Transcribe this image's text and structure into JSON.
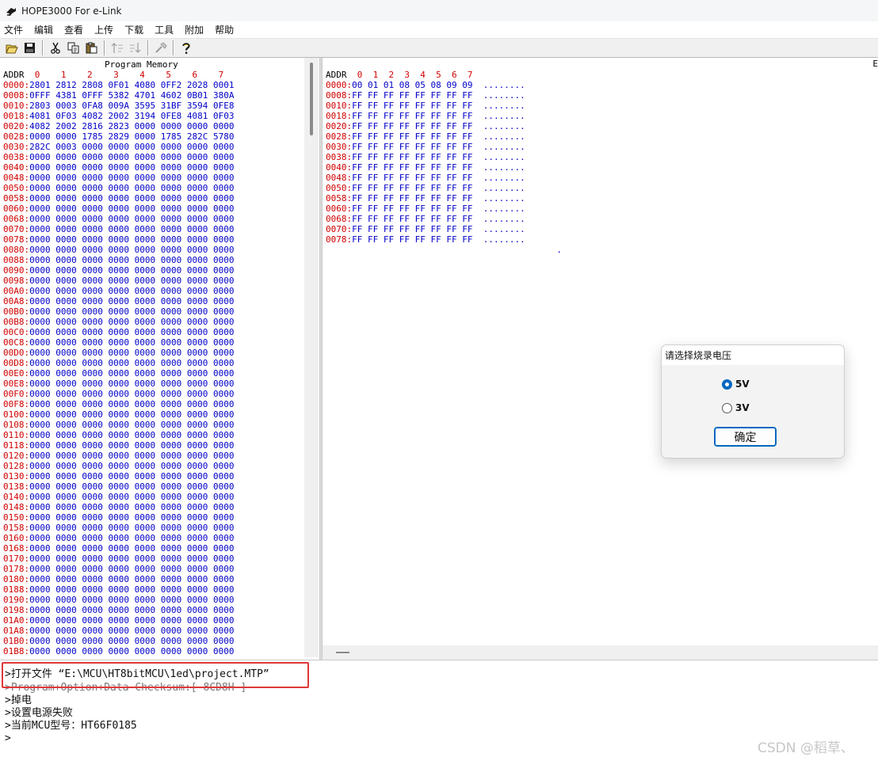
{
  "window": {
    "title": "HOPE3000 For e-Link"
  },
  "menu": [
    "文件",
    "编辑",
    "查看",
    "上传",
    "下载",
    "工具",
    "附加",
    "帮助"
  ],
  "toolbar": {
    "icons": [
      "open-folder-icon",
      "save-icon",
      "cut-icon",
      "copy-icon",
      "paste-icon",
      "upload-icon",
      "download-icon",
      "tool-icon",
      "help-icon"
    ]
  },
  "program_memory": {
    "title": "Program Memory",
    "addr_label": "ADDR",
    "columns": [
      "0",
      "1",
      "2",
      "3",
      "4",
      "5",
      "6",
      "7"
    ],
    "rows": [
      {
        "addr": "0000",
        "values": [
          "2801",
          "2812",
          "2808",
          "0F01",
          "4080",
          "0FF2",
          "2028",
          "0001"
        ]
      },
      {
        "addr": "0008",
        "values": [
          "0FFF",
          "4381",
          "0FFF",
          "5382",
          "4701",
          "4602",
          "0B01",
          "380A"
        ]
      },
      {
        "addr": "0010",
        "values": [
          "2803",
          "0003",
          "0FA8",
          "009A",
          "3595",
          "31BF",
          "3594",
          "0FE8"
        ]
      },
      {
        "addr": "0018",
        "values": [
          "4081",
          "0F03",
          "4082",
          "2002",
          "3194",
          "0FE8",
          "4081",
          "0F03"
        ]
      },
      {
        "addr": "0020",
        "values": [
          "4082",
          "2002",
          "2816",
          "2823",
          "0000",
          "0000",
          "0000",
          "0000"
        ]
      },
      {
        "addr": "0028",
        "values": [
          "0000",
          "0000",
          "1785",
          "2829",
          "0000",
          "1785",
          "282C",
          "5780"
        ]
      },
      {
        "addr": "0030",
        "values": [
          "282C",
          "0003",
          "0000",
          "0000",
          "0000",
          "0000",
          "0000",
          "0000"
        ]
      },
      {
        "addr": "0038",
        "values": [
          "0000",
          "0000",
          "0000",
          "0000",
          "0000",
          "0000",
          "0000",
          "0000"
        ]
      },
      {
        "addr": "0040",
        "values": [
          "0000",
          "0000",
          "0000",
          "0000",
          "0000",
          "0000",
          "0000",
          "0000"
        ]
      },
      {
        "addr": "0048",
        "values": [
          "0000",
          "0000",
          "0000",
          "0000",
          "0000",
          "0000",
          "0000",
          "0000"
        ]
      },
      {
        "addr": "0050",
        "values": [
          "0000",
          "0000",
          "0000",
          "0000",
          "0000",
          "0000",
          "0000",
          "0000"
        ]
      },
      {
        "addr": "0058",
        "values": [
          "0000",
          "0000",
          "0000",
          "0000",
          "0000",
          "0000",
          "0000",
          "0000"
        ]
      },
      {
        "addr": "0060",
        "values": [
          "0000",
          "0000",
          "0000",
          "0000",
          "0000",
          "0000",
          "0000",
          "0000"
        ]
      },
      {
        "addr": "0068",
        "values": [
          "0000",
          "0000",
          "0000",
          "0000",
          "0000",
          "0000",
          "0000",
          "0000"
        ]
      },
      {
        "addr": "0070",
        "values": [
          "0000",
          "0000",
          "0000",
          "0000",
          "0000",
          "0000",
          "0000",
          "0000"
        ]
      },
      {
        "addr": "0078",
        "values": [
          "0000",
          "0000",
          "0000",
          "0000",
          "0000",
          "0000",
          "0000",
          "0000"
        ]
      },
      {
        "addr": "0080",
        "values": [
          "0000",
          "0000",
          "0000",
          "0000",
          "0000",
          "0000",
          "0000",
          "0000"
        ]
      },
      {
        "addr": "0088",
        "values": [
          "0000",
          "0000",
          "0000",
          "0000",
          "0000",
          "0000",
          "0000",
          "0000"
        ]
      },
      {
        "addr": "0090",
        "values": [
          "0000",
          "0000",
          "0000",
          "0000",
          "0000",
          "0000",
          "0000",
          "0000"
        ]
      },
      {
        "addr": "0098",
        "values": [
          "0000",
          "0000",
          "0000",
          "0000",
          "0000",
          "0000",
          "0000",
          "0000"
        ]
      },
      {
        "addr": "00A0",
        "values": [
          "0000",
          "0000",
          "0000",
          "0000",
          "0000",
          "0000",
          "0000",
          "0000"
        ]
      },
      {
        "addr": "00A8",
        "values": [
          "0000",
          "0000",
          "0000",
          "0000",
          "0000",
          "0000",
          "0000",
          "0000"
        ]
      },
      {
        "addr": "00B0",
        "values": [
          "0000",
          "0000",
          "0000",
          "0000",
          "0000",
          "0000",
          "0000",
          "0000"
        ]
      },
      {
        "addr": "00B8",
        "values": [
          "0000",
          "0000",
          "0000",
          "0000",
          "0000",
          "0000",
          "0000",
          "0000"
        ]
      },
      {
        "addr": "00C0",
        "values": [
          "0000",
          "0000",
          "0000",
          "0000",
          "0000",
          "0000",
          "0000",
          "0000"
        ]
      },
      {
        "addr": "00C8",
        "values": [
          "0000",
          "0000",
          "0000",
          "0000",
          "0000",
          "0000",
          "0000",
          "0000"
        ]
      },
      {
        "addr": "00D0",
        "values": [
          "0000",
          "0000",
          "0000",
          "0000",
          "0000",
          "0000",
          "0000",
          "0000"
        ]
      },
      {
        "addr": "00D8",
        "values": [
          "0000",
          "0000",
          "0000",
          "0000",
          "0000",
          "0000",
          "0000",
          "0000"
        ]
      },
      {
        "addr": "00E0",
        "values": [
          "0000",
          "0000",
          "0000",
          "0000",
          "0000",
          "0000",
          "0000",
          "0000"
        ]
      },
      {
        "addr": "00E8",
        "values": [
          "0000",
          "0000",
          "0000",
          "0000",
          "0000",
          "0000",
          "0000",
          "0000"
        ]
      },
      {
        "addr": "00F0",
        "values": [
          "0000",
          "0000",
          "0000",
          "0000",
          "0000",
          "0000",
          "0000",
          "0000"
        ]
      },
      {
        "addr": "00F8",
        "values": [
          "0000",
          "0000",
          "0000",
          "0000",
          "0000",
          "0000",
          "0000",
          "0000"
        ]
      },
      {
        "addr": "0100",
        "values": [
          "0000",
          "0000",
          "0000",
          "0000",
          "0000",
          "0000",
          "0000",
          "0000"
        ]
      },
      {
        "addr": "0108",
        "values": [
          "0000",
          "0000",
          "0000",
          "0000",
          "0000",
          "0000",
          "0000",
          "0000"
        ]
      },
      {
        "addr": "0110",
        "values": [
          "0000",
          "0000",
          "0000",
          "0000",
          "0000",
          "0000",
          "0000",
          "0000"
        ]
      },
      {
        "addr": "0118",
        "values": [
          "0000",
          "0000",
          "0000",
          "0000",
          "0000",
          "0000",
          "0000",
          "0000"
        ]
      },
      {
        "addr": "0120",
        "values": [
          "0000",
          "0000",
          "0000",
          "0000",
          "0000",
          "0000",
          "0000",
          "0000"
        ]
      },
      {
        "addr": "0128",
        "values": [
          "0000",
          "0000",
          "0000",
          "0000",
          "0000",
          "0000",
          "0000",
          "0000"
        ]
      },
      {
        "addr": "0130",
        "values": [
          "0000",
          "0000",
          "0000",
          "0000",
          "0000",
          "0000",
          "0000",
          "0000"
        ]
      },
      {
        "addr": "0138",
        "values": [
          "0000",
          "0000",
          "0000",
          "0000",
          "0000",
          "0000",
          "0000",
          "0000"
        ]
      },
      {
        "addr": "0140",
        "values": [
          "0000",
          "0000",
          "0000",
          "0000",
          "0000",
          "0000",
          "0000",
          "0000"
        ]
      },
      {
        "addr": "0148",
        "values": [
          "0000",
          "0000",
          "0000",
          "0000",
          "0000",
          "0000",
          "0000",
          "0000"
        ]
      },
      {
        "addr": "0150",
        "values": [
          "0000",
          "0000",
          "0000",
          "0000",
          "0000",
          "0000",
          "0000",
          "0000"
        ]
      },
      {
        "addr": "0158",
        "values": [
          "0000",
          "0000",
          "0000",
          "0000",
          "0000",
          "0000",
          "0000",
          "0000"
        ]
      },
      {
        "addr": "0160",
        "values": [
          "0000",
          "0000",
          "0000",
          "0000",
          "0000",
          "0000",
          "0000",
          "0000"
        ]
      },
      {
        "addr": "0168",
        "values": [
          "0000",
          "0000",
          "0000",
          "0000",
          "0000",
          "0000",
          "0000",
          "0000"
        ]
      },
      {
        "addr": "0170",
        "values": [
          "0000",
          "0000",
          "0000",
          "0000",
          "0000",
          "0000",
          "0000",
          "0000"
        ]
      },
      {
        "addr": "0178",
        "values": [
          "0000",
          "0000",
          "0000",
          "0000",
          "0000",
          "0000",
          "0000",
          "0000"
        ]
      },
      {
        "addr": "0180",
        "values": [
          "0000",
          "0000",
          "0000",
          "0000",
          "0000",
          "0000",
          "0000",
          "0000"
        ]
      },
      {
        "addr": "0188",
        "values": [
          "0000",
          "0000",
          "0000",
          "0000",
          "0000",
          "0000",
          "0000",
          "0000"
        ]
      },
      {
        "addr": "0190",
        "values": [
          "0000",
          "0000",
          "0000",
          "0000",
          "0000",
          "0000",
          "0000",
          "0000"
        ]
      },
      {
        "addr": "0198",
        "values": [
          "0000",
          "0000",
          "0000",
          "0000",
          "0000",
          "0000",
          "0000",
          "0000"
        ]
      },
      {
        "addr": "01A0",
        "values": [
          "0000",
          "0000",
          "0000",
          "0000",
          "0000",
          "0000",
          "0000",
          "0000"
        ]
      },
      {
        "addr": "01A8",
        "values": [
          "0000",
          "0000",
          "0000",
          "0000",
          "0000",
          "0000",
          "0000",
          "0000"
        ]
      },
      {
        "addr": "01B0",
        "values": [
          "0000",
          "0000",
          "0000",
          "0000",
          "0000",
          "0000",
          "0000",
          "0000"
        ]
      },
      {
        "addr": "01B8",
        "values": [
          "0000",
          "0000",
          "0000",
          "0000",
          "0000",
          "0000",
          "0000",
          "0000"
        ]
      }
    ]
  },
  "data_memory": {
    "edge_label": "E",
    "addr_label": "ADDR",
    "columns": [
      "0",
      "1",
      "2",
      "3",
      "4",
      "5",
      "6",
      "7"
    ],
    "rows": [
      {
        "addr": "0000",
        "values": [
          "00",
          "01",
          "01",
          "08",
          "05",
          "08",
          "09",
          "09"
        ],
        "ascii": "........"
      },
      {
        "addr": "0008",
        "values": [
          "FF",
          "FF",
          "FF",
          "FF",
          "FF",
          "FF",
          "FF",
          "FF"
        ],
        "ascii": "........"
      },
      {
        "addr": "0010",
        "values": [
          "FF",
          "FF",
          "FF",
          "FF",
          "FF",
          "FF",
          "FF",
          "FF"
        ],
        "ascii": "........"
      },
      {
        "addr": "0018",
        "values": [
          "FF",
          "FF",
          "FF",
          "FF",
          "FF",
          "FF",
          "FF",
          "FF"
        ],
        "ascii": "........"
      },
      {
        "addr": "0020",
        "values": [
          "FF",
          "FF",
          "FF",
          "FF",
          "FF",
          "FF",
          "FF",
          "FF"
        ],
        "ascii": "........"
      },
      {
        "addr": "0028",
        "values": [
          "FF",
          "FF",
          "FF",
          "FF",
          "FF",
          "FF",
          "FF",
          "FF"
        ],
        "ascii": "........"
      },
      {
        "addr": "0030",
        "values": [
          "FF",
          "FF",
          "FF",
          "FF",
          "FF",
          "FF",
          "FF",
          "FF"
        ],
        "ascii": "........"
      },
      {
        "addr": "0038",
        "values": [
          "FF",
          "FF",
          "FF",
          "FF",
          "FF",
          "FF",
          "FF",
          "FF"
        ],
        "ascii": "........"
      },
      {
        "addr": "0040",
        "values": [
          "FF",
          "FF",
          "FF",
          "FF",
          "FF",
          "FF",
          "FF",
          "FF"
        ],
        "ascii": "........"
      },
      {
        "addr": "0048",
        "values": [
          "FF",
          "FF",
          "FF",
          "FF",
          "FF",
          "FF",
          "FF",
          "FF"
        ],
        "ascii": "........"
      },
      {
        "addr": "0050",
        "values": [
          "FF",
          "FF",
          "FF",
          "FF",
          "FF",
          "FF",
          "FF",
          "FF"
        ],
        "ascii": "........"
      },
      {
        "addr": "0058",
        "values": [
          "FF",
          "FF",
          "FF",
          "FF",
          "FF",
          "FF",
          "FF",
          "FF"
        ],
        "ascii": "........"
      },
      {
        "addr": "0060",
        "values": [
          "FF",
          "FF",
          "FF",
          "FF",
          "FF",
          "FF",
          "FF",
          "FF"
        ],
        "ascii": "........"
      },
      {
        "addr": "0068",
        "values": [
          "FF",
          "FF",
          "FF",
          "FF",
          "FF",
          "FF",
          "FF",
          "FF"
        ],
        "ascii": "........"
      },
      {
        "addr": "0070",
        "values": [
          "FF",
          "FF",
          "FF",
          "FF",
          "FF",
          "FF",
          "FF",
          "FF"
        ],
        "ascii": "........"
      },
      {
        "addr": "0078",
        "values": [
          "FF",
          "FF",
          "FF",
          "FF",
          "FF",
          "FF",
          "FF",
          "FF"
        ],
        "ascii": "........"
      }
    ],
    "trailing_ascii": "."
  },
  "log": {
    "lines": [
      ">打开文件 “E:\\MCU\\HT8bitMCU\\1ed\\project.MTP”",
      ">Program+Option+Data Checksum:[ 8CD8H ]",
      ">掉电",
      ">设置电源失败",
      ">当前MCU型号：HT66F0185",
      ">"
    ]
  },
  "dialog": {
    "title": "请选择烧录电压",
    "options": [
      {
        "label": "5V",
        "checked": true
      },
      {
        "label": "3V",
        "checked": false
      }
    ],
    "ok_label": "确定"
  },
  "watermark": "CSDN @稻草、",
  "colors": {
    "address": "#d00000",
    "value": "#0000c8",
    "accent": "#0067c0",
    "highlight": "#e03838"
  }
}
